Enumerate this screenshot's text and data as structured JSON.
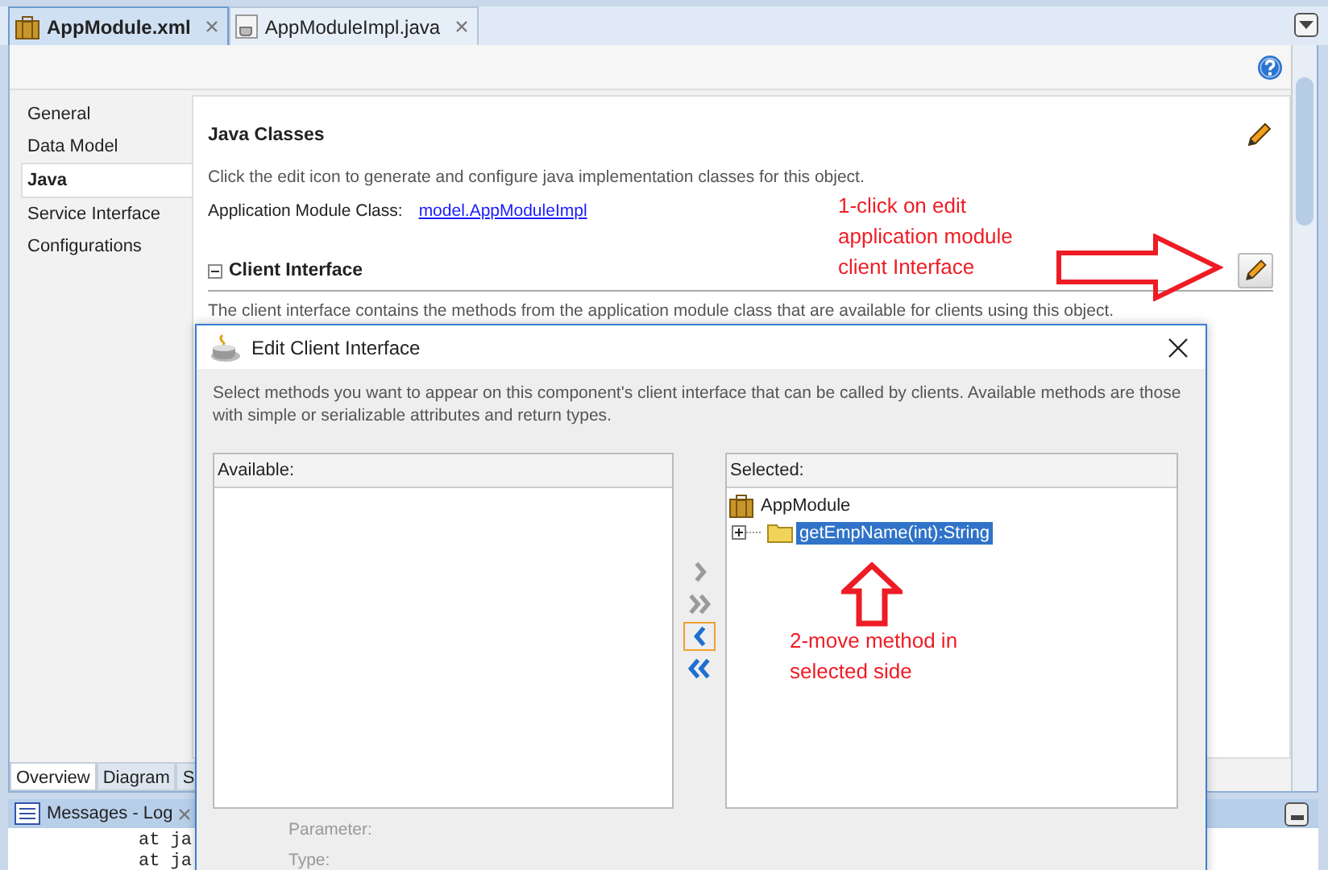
{
  "editor_tabs": [
    {
      "label": "AppModule.xml",
      "selected": true,
      "kind": "module"
    },
    {
      "label": "AppModuleImpl.java",
      "selected": false,
      "kind": "java"
    }
  ],
  "nav": [
    {
      "label": "General",
      "selected": false
    },
    {
      "label": "Data Model",
      "selected": false
    },
    {
      "label": "Java",
      "selected": true
    },
    {
      "label": "Service Interface",
      "selected": false
    },
    {
      "label": "Configurations",
      "selected": false
    }
  ],
  "java_classes": {
    "heading": "Java Classes",
    "description": "Click the edit icon to generate and configure java implementation classes for this object.",
    "class_label": "Application Module Class:",
    "class_link": "model.AppModuleImpl"
  },
  "client_interface": {
    "heading": "Client Interface",
    "expanded": true,
    "description": "The client interface contains the methods from the application module class that are available for clients using this object."
  },
  "bottom_tabs": [
    {
      "label": "Overview",
      "selected": true
    },
    {
      "label": "Diagram",
      "selected": false
    },
    {
      "label": "S",
      "selected": false
    }
  ],
  "log": {
    "title": "Messages - Log",
    "lines": [
      "at ja",
      "at ja"
    ]
  },
  "dialog": {
    "title": "Edit Client Interface",
    "description": "Select methods you want to appear on this component's client interface that can be called by clients.  Available methods are those with simple or serializable attributes and return types.",
    "available": {
      "label": "Available:"
    },
    "selected": {
      "label": "Selected:",
      "tree": [
        {
          "label": "AppModule",
          "kind": "module",
          "children": [
            {
              "label": "getEmpName(int):String",
              "kind": "folder",
              "selected": true,
              "expanded": false
            }
          ]
        }
      ]
    },
    "shuttle": [
      {
        "kind": "add",
        "disabled": true,
        "focused": false
      },
      {
        "kind": "add-all",
        "disabled": true,
        "focused": false
      },
      {
        "kind": "remove",
        "disabled": false,
        "focused": true
      },
      {
        "kind": "remove-all",
        "disabled": false,
        "focused": false
      }
    ],
    "fields": [
      {
        "label": "Parameter:"
      },
      {
        "label": "Type:"
      }
    ]
  },
  "annotations": [
    {
      "kind": "right-arrow",
      "text": "1-click on edit application module client Interface"
    },
    {
      "kind": "up-arrow",
      "text": "2-move method in selected side"
    }
  ]
}
